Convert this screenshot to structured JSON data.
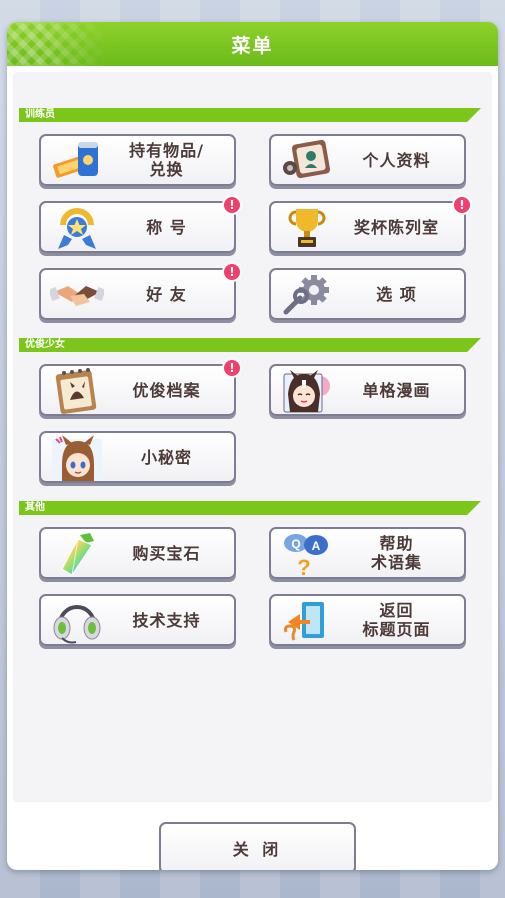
{
  "dialog": {
    "title": "菜单"
  },
  "sections": {
    "trainer": "训练员",
    "umamusume": "优俊少女",
    "other": "其他"
  },
  "buttons": {
    "items_exchange": {
      "label": "持有物品/\n兑换",
      "icon": "ticket-can-icon",
      "badge": ""
    },
    "profile": {
      "label": "个人资料",
      "icon": "profile-card-icon",
      "badge": ""
    },
    "title": {
      "label": "称 号",
      "icon": "horseshoe-medal-icon",
      "badge": "!"
    },
    "trophy_room": {
      "label": "奖杯陈列室",
      "icon": "trophy-icon",
      "badge": "!"
    },
    "friends": {
      "label": "好 友",
      "icon": "handshake-icon",
      "badge": "!"
    },
    "options": {
      "label": "选 项",
      "icon": "gear-wrench-icon",
      "badge": ""
    },
    "uma_archive": {
      "label": "优俊档案",
      "icon": "notepad-icon",
      "badge": "!"
    },
    "comic": {
      "label": "单格漫画",
      "icon": "chibi-comic-icon",
      "badge": ""
    },
    "secrets": {
      "label": "小秘密",
      "icon": "chibi-girl-icon",
      "badge": ""
    },
    "buy_gems": {
      "label": "购买宝石",
      "icon": "rainbow-gem-icon",
      "badge": ""
    },
    "help": {
      "label": "帮助\n术语集",
      "icon": "qa-bubble-icon",
      "badge": ""
    },
    "support": {
      "label": "技术支持",
      "icon": "headset-icon",
      "badge": ""
    },
    "return_title": {
      "label": "返回\n标题页面",
      "icon": "exit-door-icon",
      "badge": ""
    }
  },
  "close": {
    "label": "关 闭"
  },
  "colors": {
    "accent": "#7cc61c",
    "badge": "#ef3f6c",
    "text": "#4b3a38"
  }
}
